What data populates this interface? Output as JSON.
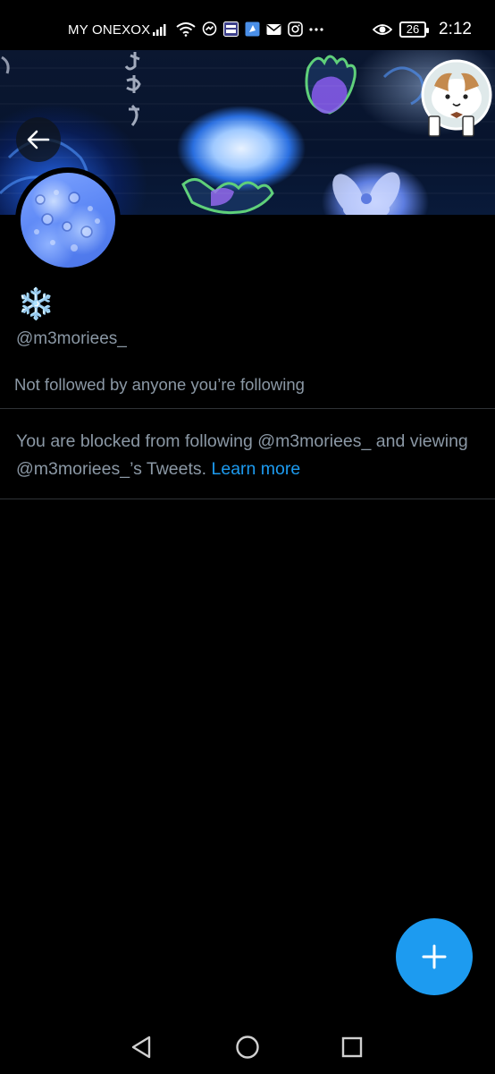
{
  "status_bar": {
    "carrier": "MY ONEXOX",
    "battery": "26",
    "time": "2:12",
    "notification_icons": [
      "signal-icon",
      "wifi-icon",
      "messenger-icon",
      "live-app-icon",
      "app-icon",
      "mail-icon",
      "instagram-icon",
      "more-dots-icon"
    ]
  },
  "profile": {
    "display_name": "❄️",
    "handle": "@m3moriees_",
    "followers_note": "Not followed by anyone you’re following",
    "blocked_message": "You are blocked from following @m3moriees_ and viewing @m3moriees_’s Tweets.",
    "learn_more": "Learn more"
  },
  "colors": {
    "accent": "#1d9bf0",
    "background": "#000000",
    "secondary_text": "#8b98a5",
    "divider": "#2f3336"
  },
  "navigation": {
    "back": "back-arrow-icon",
    "home": "home-circle-icon",
    "recents": "recents-square-icon"
  }
}
